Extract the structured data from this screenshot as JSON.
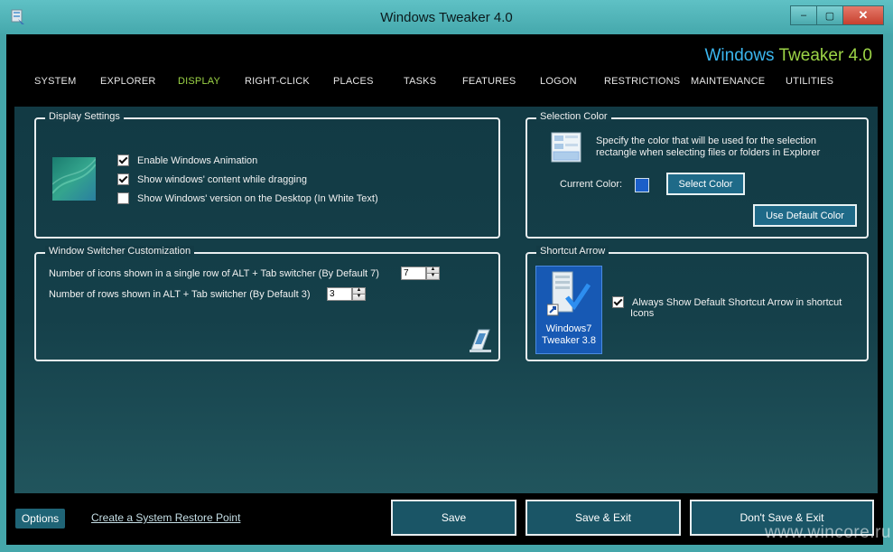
{
  "window": {
    "title": "Windows Tweaker 4.0",
    "controls": {
      "minimize": "–",
      "maximize": "▢",
      "close": "✕"
    }
  },
  "brand": {
    "part1": "Windows ",
    "part2": "Tweaker 4.0"
  },
  "nav": {
    "tabs": [
      {
        "label": "SYSTEM"
      },
      {
        "label": "EXPLORER"
      },
      {
        "label": "DISPLAY"
      },
      {
        "label": "RIGHT-CLICK"
      },
      {
        "label": "PLACES"
      },
      {
        "label": "TASKS"
      },
      {
        "label": "FEATURES"
      },
      {
        "label": "LOGON"
      },
      {
        "label": "RESTRICTIONS"
      },
      {
        "label": "MAINTENANCE"
      },
      {
        "label": "UTILITIES"
      }
    ],
    "active": "DISPLAY"
  },
  "display_settings": {
    "title": "Display Settings",
    "options": [
      {
        "label": "Enable Windows Animation",
        "checked": true
      },
      {
        "label": "Show windows' content while dragging",
        "checked": true
      },
      {
        "label": "Show Windows' version on the Desktop (In White Text)",
        "checked": false
      }
    ]
  },
  "selection_color": {
    "title": "Selection Color",
    "description_line1": "Specify the color that will be used for the selection",
    "description_line2": "rectangle when selecting files or folders in Explorer",
    "current_color_label": "Current Color:",
    "current_color": "#1b5fc9",
    "select_button": "Select Color",
    "default_button": "Use Default Color"
  },
  "switcher": {
    "title": "Window Switcher Customization",
    "icons_label": "Number of icons shown in a single row of ALT + Tab switcher (By Default 7)",
    "icons_value": "7",
    "rows_label": "Number of rows shown in ALT + Tab switcher (By Default 3)",
    "rows_value": "3"
  },
  "shortcut_arrow": {
    "title": "Shortcut Arrow",
    "icon_caption_line1": "Windows7",
    "icon_caption_line2": "Tweaker 3.8",
    "checkbox_line1": "Always Show Default Shortcut Arrow in shortcut",
    "checkbox_line2": "Icons",
    "checked": true
  },
  "footer": {
    "options": "Options",
    "restore_link": "Create a System Restore Point",
    "save": "Save",
    "save_exit": "Save & Exit",
    "dont_save": "Don't Save & Exit"
  },
  "watermark": "www.wincore.ru",
  "colors": {
    "accent": "#9cd446",
    "brand_blue": "#3bb6ef",
    "frame": "#45a6aa",
    "panel": "#133b45"
  }
}
